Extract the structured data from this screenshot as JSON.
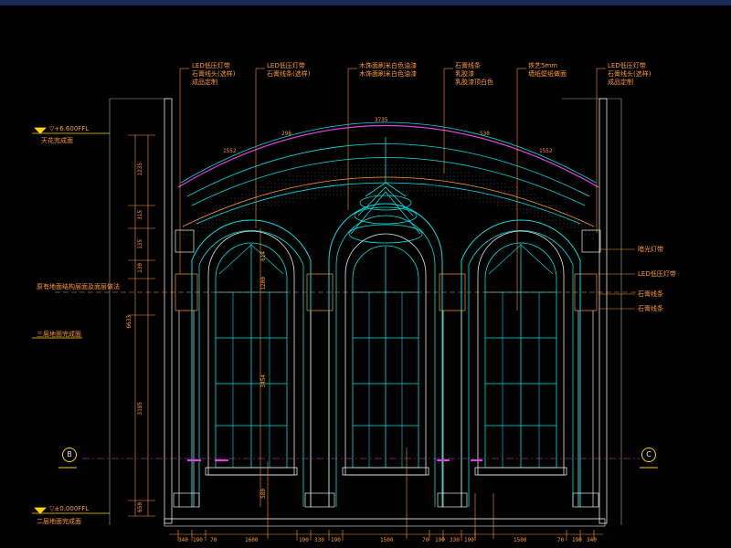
{
  "annotations_top": [
    {
      "line1": "LED低压灯带",
      "line2": "石膏线头(选样)",
      "line3": "成品定制"
    },
    {
      "line1": "LED低压灯带",
      "line2": "石膏线条(选样)",
      "line3": ""
    },
    {
      "line1": "木饰面刷米白色油漆",
      "line2": "木饰面刷米白色油漆",
      "line3": ""
    },
    {
      "line1": "石膏线条",
      "line2": "乳胶漆",
      "line3": "乳胶漆顶白色"
    },
    {
      "line1": "铁艺5mm",
      "line2": "墙纸壁纸做面",
      "line3": ""
    },
    {
      "line1": "LED低压灯带",
      "line2": "石膏线头(选样)",
      "line3": "成品定制"
    }
  ],
  "annotations_left": [
    {
      "line1": "▽+6.600FFL",
      "line2": "天花完成面"
    },
    {
      "line1": "原有地面结构层面及面层做法",
      "line2": ""
    },
    {
      "line1": "三层地面完成面",
      "line2": ""
    },
    {
      "line1": "▽±0.000FFL",
      "line2": "二层地面完成面"
    }
  ],
  "annotations_right": [
    "暗光灯带",
    "LED低压灯带",
    "石膏线条",
    "石膏线条"
  ],
  "top_dims": [
    "3735",
    "298",
    "1552",
    "530",
    "1552"
  ],
  "left_dims": [
    "1235",
    "315",
    "135",
    "130",
    "6633",
    "3185",
    "650"
  ],
  "mid_dims": [
    "614",
    "1200",
    "3454",
    "580"
  ],
  "bottom_dims": [
    "340",
    "190",
    "70",
    "1600",
    "190",
    "330",
    "190",
    "1500",
    "70",
    "190",
    "330",
    "190",
    "1500",
    "70",
    "190",
    "340"
  ],
  "axes": {
    "left": "B",
    "right": "C"
  },
  "colors": {
    "cyan": "#00e0e0",
    "magenta": "#e040e0",
    "orange": "#ff9a2e",
    "yellow": "#ffd400",
    "white": "#e8e8e8"
  }
}
